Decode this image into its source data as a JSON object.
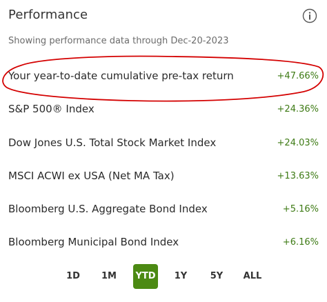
{
  "header": {
    "title": "Performance",
    "subtitle": "Showing performance data through Dec-20-2023"
  },
  "rows": [
    {
      "label": "Your year-to-date cumulative pre-tax return",
      "value": "+47.66%"
    },
    {
      "label": "S&P 500® Index",
      "value": "+24.36%"
    },
    {
      "label": "Dow Jones U.S. Total Stock Market Index",
      "value": "+24.03%"
    },
    {
      "label": "MSCI ACWI ex USA (Net MA Tax)",
      "value": "+13.63%"
    },
    {
      "label": "Bloomberg U.S. Aggregate Bond Index",
      "value": "+5.16%"
    },
    {
      "label": "Bloomberg Municipal Bond Index",
      "value": "+6.16%"
    }
  ],
  "tabs": [
    {
      "label": "1D",
      "active": false
    },
    {
      "label": "1M",
      "active": false
    },
    {
      "label": "YTD",
      "active": true
    },
    {
      "label": "1Y",
      "active": false
    },
    {
      "label": "5Y",
      "active": false
    },
    {
      "label": "ALL",
      "active": false
    }
  ],
  "colors": {
    "positive": "#3d7a14",
    "active_tab": "#4c8a13",
    "annotation_ring": "#d40000"
  },
  "icons": {
    "info": "info-circle-icon"
  }
}
